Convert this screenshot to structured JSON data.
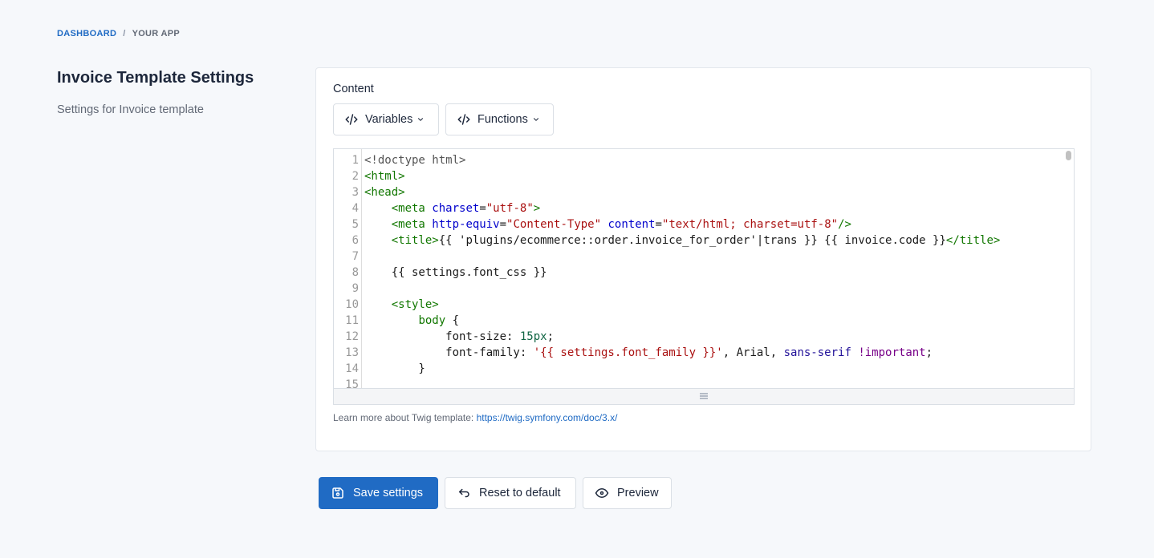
{
  "breadcrumb": {
    "items": [
      "DASHBOARD",
      "YOUR APP"
    ],
    "separator": "/"
  },
  "sidebar": {
    "title": "Invoice Template Settings",
    "description": "Settings for Invoice template"
  },
  "card": {
    "label": "Content",
    "variables_label": "Variables",
    "functions_label": "Functions",
    "help_text": "Learn more about Twig template:",
    "help_link": "https://twig.symfony.com/doc/3.x/"
  },
  "editor": {
    "lines": [
      {
        "n": "1",
        "parts": [
          [
            "plain",
            "<!doctype html>"
          ]
        ]
      },
      {
        "n": "2",
        "parts": [
          [
            "tag",
            "<html>"
          ]
        ]
      },
      {
        "n": "3",
        "parts": [
          [
            "tag",
            "<head>"
          ]
        ]
      },
      {
        "n": "4",
        "parts": [
          [
            "prop",
            "    "
          ],
          [
            "tag",
            "<meta "
          ],
          [
            "attr",
            "charset"
          ],
          [
            "prop",
            "="
          ],
          [
            "str",
            "\"utf-8\""
          ],
          [
            "tag",
            ">"
          ]
        ]
      },
      {
        "n": "5",
        "parts": [
          [
            "prop",
            "    "
          ],
          [
            "tag",
            "<meta "
          ],
          [
            "attr",
            "http-equiv"
          ],
          [
            "prop",
            "="
          ],
          [
            "str",
            "\"Content-Type\""
          ],
          [
            "prop",
            " "
          ],
          [
            "attr",
            "content"
          ],
          [
            "prop",
            "="
          ],
          [
            "str",
            "\"text/html; charset=utf-8\""
          ],
          [
            "tag",
            "/>"
          ]
        ]
      },
      {
        "n": "6",
        "parts": [
          [
            "prop",
            "    "
          ],
          [
            "tag",
            "<title>"
          ],
          [
            "prop",
            "{{ 'plugins/ecommerce::order.invoice_for_order'|trans }} {{ invoice.code }}"
          ],
          [
            "tag",
            "</title>"
          ]
        ]
      },
      {
        "n": "7",
        "parts": [
          [
            "prop",
            ""
          ]
        ]
      },
      {
        "n": "8",
        "parts": [
          [
            "prop",
            "    {{ settings.font_css }}"
          ]
        ]
      },
      {
        "n": "9",
        "parts": [
          [
            "prop",
            ""
          ]
        ]
      },
      {
        "n": "10",
        "parts": [
          [
            "prop",
            "    "
          ],
          [
            "tag",
            "<style>"
          ]
        ]
      },
      {
        "n": "11",
        "parts": [
          [
            "prop",
            "        "
          ],
          [
            "tag",
            "body"
          ],
          [
            "prop",
            " {"
          ]
        ]
      },
      {
        "n": "12",
        "parts": [
          [
            "prop",
            "            font-size: "
          ],
          [
            "num",
            "15px"
          ],
          [
            "prop",
            ";"
          ]
        ]
      },
      {
        "n": "13",
        "parts": [
          [
            "prop",
            "            font-family: "
          ],
          [
            "str",
            "'{{ settings.font_family }}'"
          ],
          [
            "prop",
            ", Arial, "
          ],
          [
            "atom",
            "sans-serif"
          ],
          [
            "prop",
            " "
          ],
          [
            "kw",
            "!important"
          ],
          [
            "prop",
            ";"
          ]
        ]
      },
      {
        "n": "14",
        "parts": [
          [
            "prop",
            "        }"
          ]
        ]
      },
      {
        "n": "15",
        "parts": [
          [
            "prop",
            ""
          ]
        ]
      }
    ]
  },
  "actions": {
    "save": "Save settings",
    "reset": "Reset to default",
    "preview": "Preview"
  },
  "colors": {
    "primary": "#206bc4",
    "background": "#f6f8fb"
  }
}
